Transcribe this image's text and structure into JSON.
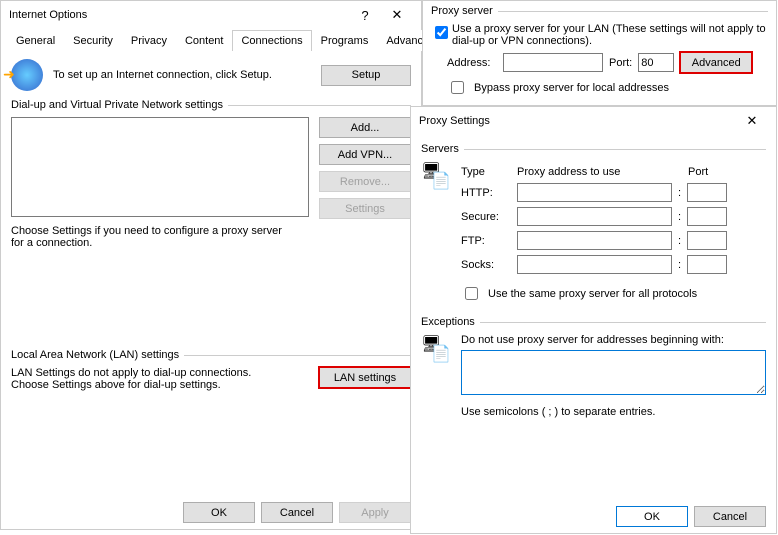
{
  "io": {
    "title": "Internet Options",
    "tabs": [
      "General",
      "Security",
      "Privacy",
      "Content",
      "Connections",
      "Programs",
      "Advanced"
    ],
    "setup_text": "To set up an Internet connection, click Setup.",
    "setup_btn": "Setup",
    "dialup_group": "Dial-up and Virtual Private Network settings",
    "add_btn": "Add...",
    "addvpn_btn": "Add VPN...",
    "remove_btn": "Remove...",
    "settings_btn": "Settings",
    "choose_text": "Choose Settings if you need to configure a proxy server for a connection.",
    "lan_group": "Local Area Network (LAN) settings",
    "lan_text1": "LAN Settings do not apply to dial-up connections.",
    "lan_text2": "Choose Settings above for dial-up settings.",
    "lan_btn": "LAN settings",
    "ok": "OK",
    "cancel": "Cancel",
    "apply": "Apply"
  },
  "lan": {
    "group": "Proxy server",
    "use_label": "Use a proxy server for your LAN (These settings will not apply to dial-up or VPN connections).",
    "addr_label": "Address:",
    "addr_value": "",
    "port_label": "Port:",
    "port_value": "80",
    "adv_btn": "Advanced",
    "bypass_label": "Bypass proxy server for local addresses"
  },
  "ps": {
    "title": "Proxy Settings",
    "servers_group": "Servers",
    "type_hdr": "Type",
    "addr_hdr": "Proxy address to use",
    "port_hdr": "Port",
    "rows": [
      {
        "label": "HTTP:"
      },
      {
        "label": "Secure:"
      },
      {
        "label": "FTP:"
      },
      {
        "label": "Socks:"
      }
    ],
    "same_label": "Use the same proxy server for all protocols",
    "ex_group": "Exceptions",
    "ex_text": "Do not use proxy server for addresses beginning with:",
    "ex_hint": "Use semicolons ( ; ) to separate entries.",
    "ok": "OK",
    "cancel": "Cancel"
  }
}
